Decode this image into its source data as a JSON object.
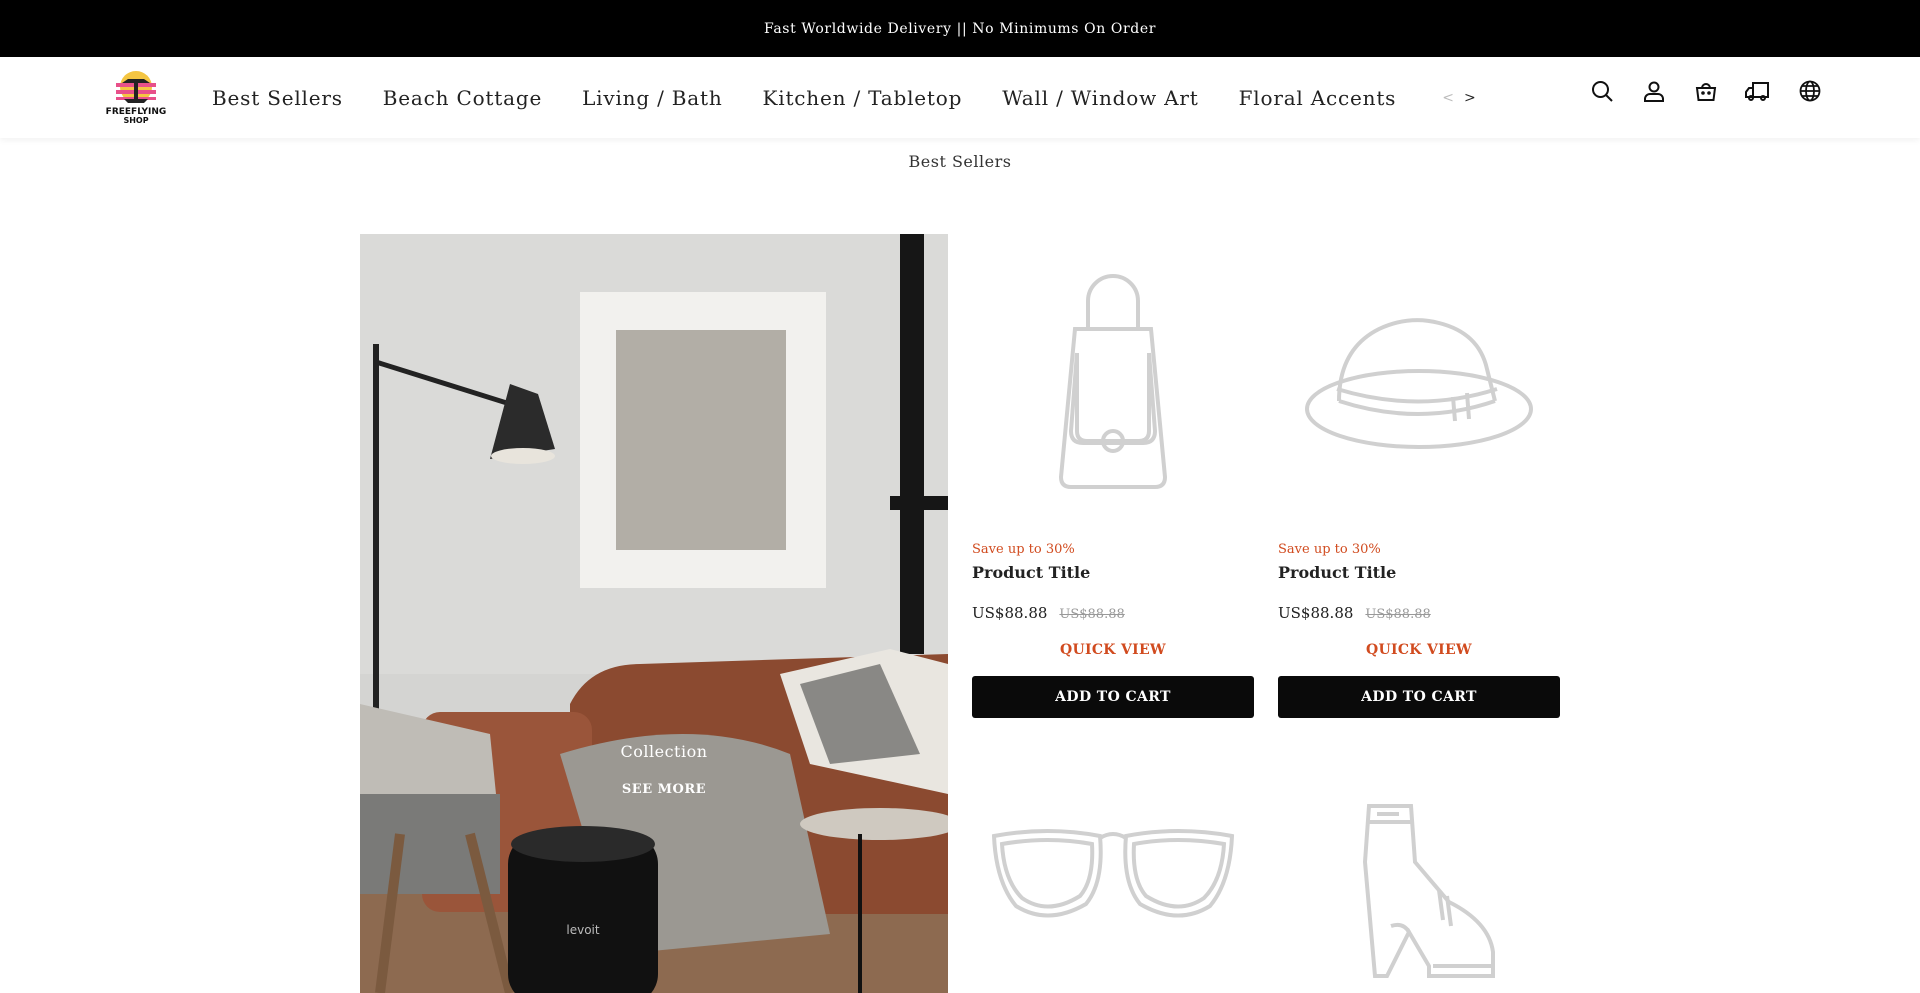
{
  "announcement": "Fast Worldwide Delivery || No Minimums On Order",
  "brand": {
    "logo_line1": "FREEFLYING",
    "logo_line2": "SHOP"
  },
  "nav": {
    "items": [
      "Best Sellers",
      "Beach Cottage",
      "Living / Bath",
      "Kitchen / Tabletop",
      "Wall / Window Art",
      "Floral Accents"
    ],
    "prev": "<",
    "next": ">"
  },
  "header_icons": [
    "search-icon",
    "account-icon",
    "cart-icon",
    "delivery-truck-icon",
    "globe-icon"
  ],
  "section": {
    "title": "Best Sellers"
  },
  "collection": {
    "label": "Collection",
    "link": "SEE MORE",
    "image_brand": "levoit"
  },
  "products": [
    {
      "icon": "handbag-icon",
      "badge": "Save up to 30%",
      "title": "Product Title",
      "price": "US$88.88",
      "compare": "US$88.88",
      "quick_view": "QUICK VIEW",
      "cta": "ADD TO CART"
    },
    {
      "icon": "hat-icon",
      "badge": "Save up to 30%",
      "title": "Product Title",
      "price": "US$88.88",
      "compare": "US$88.88",
      "quick_view": "QUICK VIEW",
      "cta": "ADD TO CART"
    },
    {
      "icon": "sunglasses-icon"
    },
    {
      "icon": "high-heel-boot-icon"
    }
  ],
  "colors": {
    "accent": "#d14b1f",
    "bar": "#000000",
    "button": "#0a0a0a"
  }
}
